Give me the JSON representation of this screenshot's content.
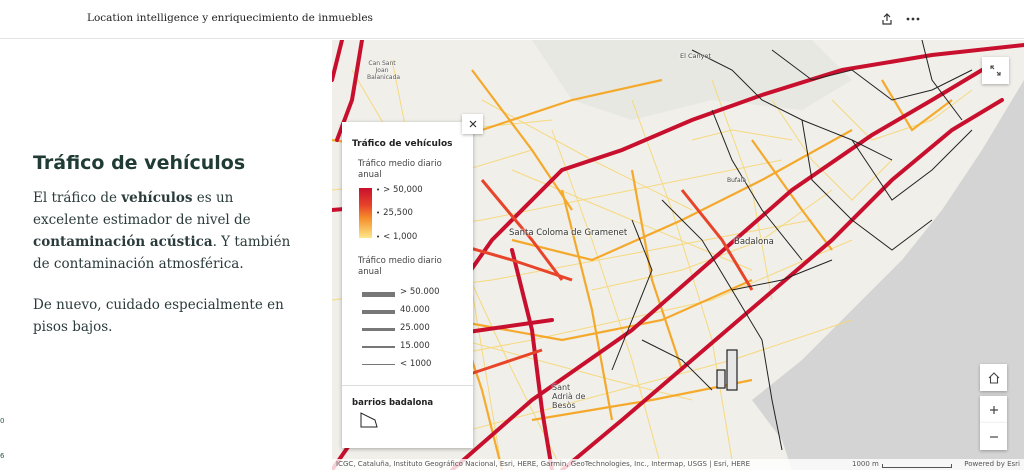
{
  "header": {
    "title": "Location intelligence y enriquecimiento de inmuebles"
  },
  "narrative": {
    "heading": "Tráfico de vehículos",
    "paragraph1": {
      "t1": "El tráfico de ",
      "b1": "vehículos",
      "t2": " es un excelente estimador de nivel de ",
      "b2": "contaminación acústica",
      "t3": ". Y también de contaminación atmosférica."
    },
    "paragraph2": "De nuevo, cuidado especialmente en pisos bajos.",
    "pager_marks": [
      "0",
      "6"
    ]
  },
  "map": {
    "places": {
      "santa_coloma": "Santa Coloma de Gramenet",
      "badalona": "Badalona",
      "sant_adria": "Sant Adrià de Besòs",
      "can_sant_joan": "Can Sant Joan Balanicada",
      "el_canyet": "El Canyet",
      "bufala": "Bufalà"
    },
    "legend": {
      "title": "Tráfico de vehículos",
      "color_title": "Tráfico medio diario anual",
      "color_labels": [
        "> 50,000",
        "25,500",
        "< 1,000"
      ],
      "width_title": "Tráfico medio diario anual",
      "width_labels": [
        "> 50.000",
        "40.000",
        "25.000",
        "15.000",
        "< 1000"
      ],
      "barrios_title": "barrios badalona"
    },
    "attribution": "ICGC, Cataluña, Instituto Geográfico Nacional, Esri, HERE, Garmin, GeoTechnologies, Inc., Intermap, USGS | Esri, HERE",
    "scale_label": "1000 m",
    "powered_by": "Powered by Esri",
    "colors": {
      "high": "#c8102e",
      "mid": "#e8442a",
      "low": "#f5a623",
      "minimal": "#fde78a",
      "sea": "#d4d4d4",
      "land": "#f0efe9"
    }
  },
  "icons": {
    "share": "share-icon",
    "more": "more-icon",
    "expand": "expand-icon",
    "close": "close-icon",
    "home": "home-icon",
    "zoom_in": "plus-icon",
    "zoom_out": "minus-icon"
  }
}
